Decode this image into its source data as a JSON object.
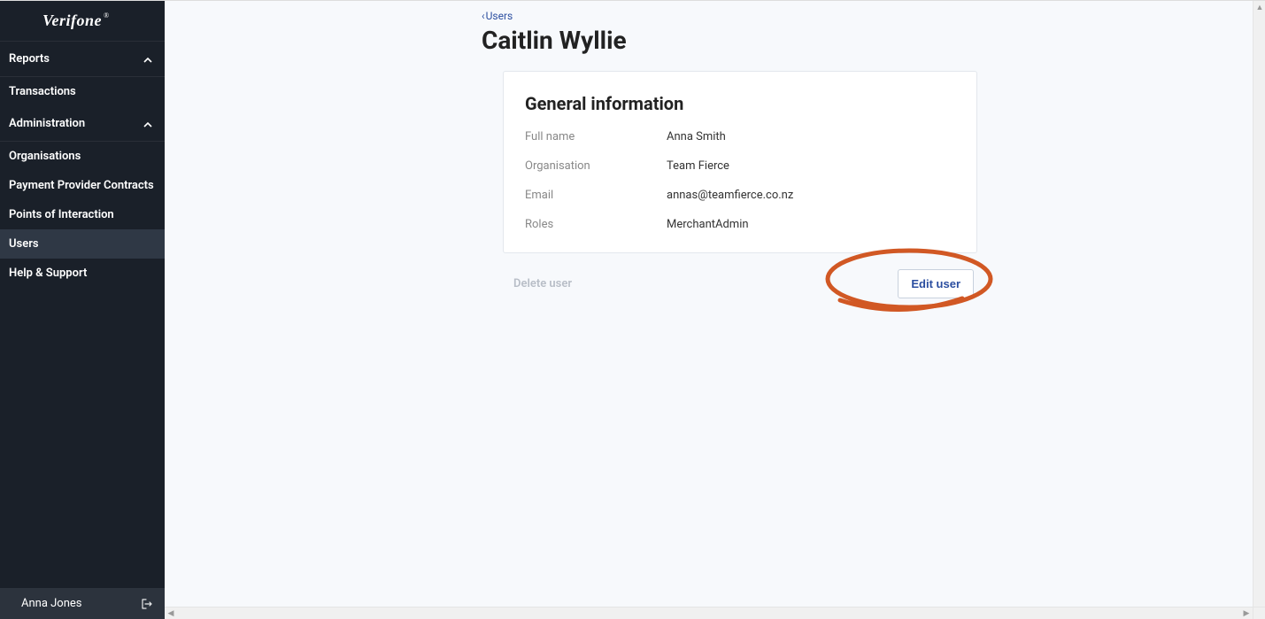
{
  "brand": "Verifone",
  "sidebar": {
    "sections": [
      {
        "label": "Reports",
        "expanded": true
      },
      {
        "label": "Administration",
        "expanded": true
      }
    ],
    "items": {
      "transactions": "Transactions",
      "organisations": "Organisations",
      "ppc": "Payment Provider Contracts",
      "poi": "Points of Interaction",
      "users": "Users",
      "help": "Help & Support"
    },
    "footer_user": "Anna Jones"
  },
  "breadcrumb": {
    "back_label": "Users"
  },
  "page": {
    "title": "Caitlin Wyllie"
  },
  "general_info": {
    "heading": "General information",
    "fields": {
      "full_name_label": "Full name",
      "full_name_value": "Anna Smith",
      "organisation_label": "Organisation",
      "organisation_value": "Team Fierce",
      "email_label": "Email",
      "email_value": "annas@teamfierce.co.nz",
      "roles_label": "Roles",
      "roles_value": "MerchantAdmin"
    }
  },
  "actions": {
    "delete_label": "Delete user",
    "edit_label": "Edit user"
  }
}
